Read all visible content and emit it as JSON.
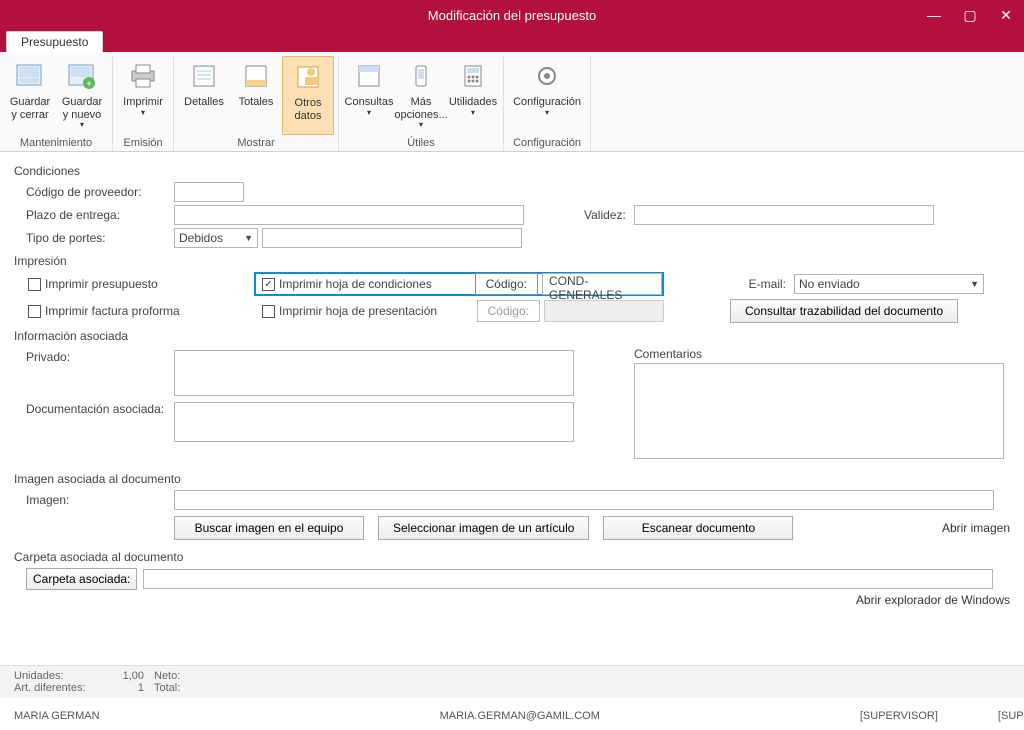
{
  "window": {
    "title": "Modificación del presupuesto"
  },
  "tab": {
    "label": "Presupuesto"
  },
  "ribbon": {
    "groups": {
      "mantenimiento": {
        "label": "Mantenimiento",
        "save_close": "Guardar y cerrar",
        "save_new": "Guardar y nuevo"
      },
      "emision": {
        "label": "Emisión",
        "print": "Imprimir"
      },
      "mostrar": {
        "label": "Mostrar",
        "details": "Detalles",
        "totals": "Totales",
        "other": "Otros datos"
      },
      "utiles": {
        "label": "Útiles",
        "queries": "Consultas",
        "more": "Más opciones...",
        "utilities": "Utilidades"
      },
      "config": {
        "label": "Configuración",
        "config": "Configuración"
      }
    }
  },
  "sections": {
    "condiciones": "Condiciones",
    "impresion": "Impresión",
    "info": "Información asociada",
    "imagen": "Imagen asociada al documento",
    "carpeta": "Carpeta asociada al documento"
  },
  "form": {
    "codigo_prov_label": "Código de proveedor:",
    "plazo_label": "Plazo de entrega:",
    "validez_label": "Validez:",
    "portes_label": "Tipo de portes:",
    "portes_value": "Debidos",
    "print_budget": "Imprimir presupuesto",
    "print_proforma": "Imprimir factura proforma",
    "print_cond": "Imprimir hoja de condiciones",
    "print_pres": "Imprimir hoja de presentación",
    "codigo_label": "Código:",
    "cond_code": "COND-GENERALES",
    "email_label": "E-mail:",
    "email_value": "No enviado",
    "trace_btn": "Consultar trazabilidad del documento",
    "privado_label": "Privado:",
    "doc_label": "Documentación asociada:",
    "comentarios_label": "Comentarios",
    "imagen_label": "Imagen:",
    "buscar_btn": "Buscar imagen en el equipo",
    "select_btn": "Seleccionar imagen de un artículo",
    "scan_btn": "Escanear documento",
    "abrir_img": "Abrir imagen",
    "carpeta_btn": "Carpeta asociada:",
    "abrir_exp": "Abrir explorador de Windows"
  },
  "status": {
    "unidades_label": "Unidades:",
    "unidades_val": "1,00",
    "art_label": "Art. diferentes:",
    "art_val": "1",
    "neto_label": "Neto:",
    "total_label": "Total:",
    "user": "MARIA GERMAN",
    "email": "MARIA.GERMAN@GAMIL.COM",
    "role1": "[SUPERVISOR]",
    "role2": "[SUPERVISOR]"
  }
}
